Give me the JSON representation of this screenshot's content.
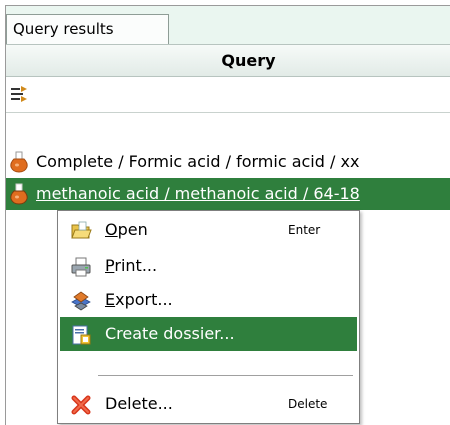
{
  "tab": {
    "label": "Query results"
  },
  "header": {
    "title": "Query"
  },
  "toolbar": {
    "icon": "filter-arrows-icon"
  },
  "results": [
    {
      "text": "Complete / Formic acid / formic acid / xx",
      "icon": "flask-icon",
      "selected": false
    },
    {
      "text": "methanoic acid / methanoic acid / 64-18",
      "icon": "flask-icon",
      "selected": true
    }
  ],
  "context_menu": {
    "items": [
      {
        "mnemonic": "O",
        "rest": "pen",
        "shortcut": "Enter",
        "icon": "folder-open-icon"
      },
      {
        "mnemonic": "P",
        "rest": "rint...",
        "shortcut": "",
        "icon": "printer-icon"
      },
      {
        "mnemonic": "E",
        "rest": "xport...",
        "shortcut": "",
        "icon": "export-icon"
      },
      {
        "label": "Create dossier...",
        "shortcut": "",
        "icon": "dossier-icon",
        "highlighted": true
      },
      {
        "label": "Delete...",
        "shortcut": "Delete",
        "icon": "delete-x-icon"
      }
    ]
  },
  "colors": {
    "selection": "#2f7f3d",
    "tab_strip": "#eaf6f0"
  }
}
